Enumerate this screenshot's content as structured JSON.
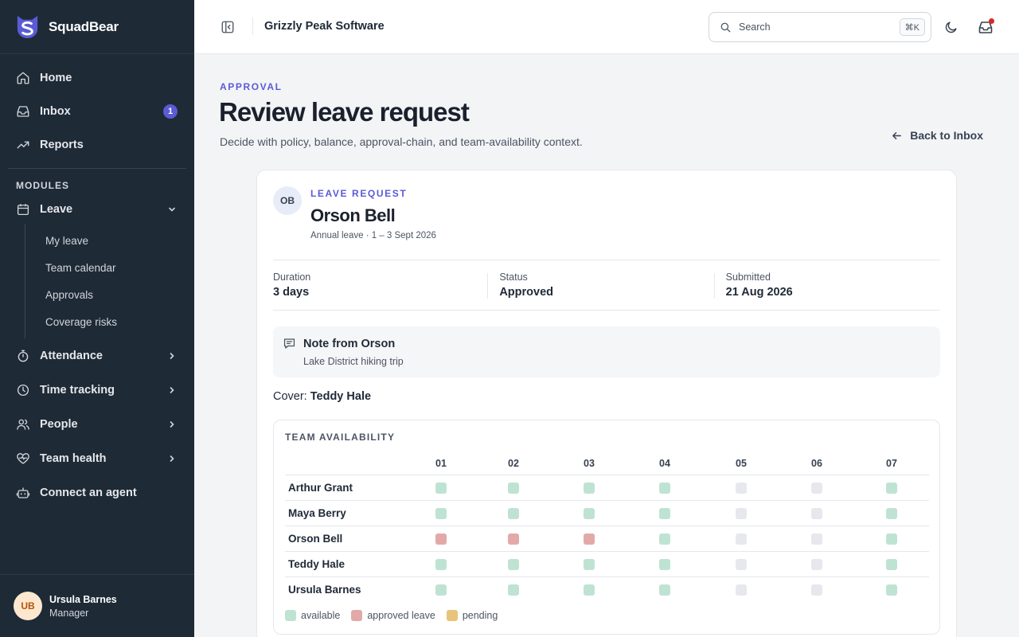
{
  "app": {
    "brand_name": "SquadBear",
    "org_name": "Grizzly Peak Software"
  },
  "sidebar": {
    "top_items": [
      {
        "label": "Home",
        "icon": "home-icon"
      },
      {
        "label": "Inbox",
        "icon": "inbox-icon",
        "badge": "1"
      },
      {
        "label": "Reports",
        "icon": "trend-up-icon"
      }
    ],
    "modules_label": "MODULES",
    "leave": {
      "label": "Leave",
      "sub_items": [
        "My leave",
        "Team calendar",
        "Approvals",
        "Coverage risks"
      ]
    },
    "groups": [
      {
        "label": "Attendance",
        "icon": "stopwatch-icon"
      },
      {
        "label": "Time tracking",
        "icon": "clock-icon"
      },
      {
        "label": "People",
        "icon": "users-icon"
      },
      {
        "label": "Team health",
        "icon": "heart-pulse-icon"
      }
    ],
    "connect_agent": "Connect an agent",
    "user": {
      "initials": "UB",
      "name": "Ursula Barnes",
      "role": "Manager"
    }
  },
  "topbar": {
    "search_placeholder": "Search",
    "search_shortcut": "⌘K"
  },
  "page": {
    "eyebrow": "APPROVAL",
    "title": "Review leave request",
    "subtitle": "Decide with policy, balance, approval-chain, and team-availability context.",
    "back_label": "Back to Inbox"
  },
  "request": {
    "initials": "OB",
    "eyebrow": "LEAVE REQUEST",
    "name": "Orson Bell",
    "meta": "Annual leave · 1 – 3 Sept 2026",
    "stats": [
      {
        "label": "Duration",
        "value": "3 days"
      },
      {
        "label": "Status",
        "value": "Approved"
      },
      {
        "label": "Submitted",
        "value": "21 Aug 2026"
      }
    ],
    "note_title": "Note from Orson",
    "note_body": "Lake District hiking trip",
    "cover_label": "Cover:",
    "cover_name": "Teddy Hale"
  },
  "availability": {
    "title": "TEAM AVAILABILITY",
    "days": [
      "01",
      "02",
      "03",
      "04",
      "05",
      "06",
      "07"
    ],
    "rows": [
      {
        "name": "Arthur Grant",
        "cells": [
          "available",
          "available",
          "available",
          "available",
          "off",
          "off",
          "available"
        ]
      },
      {
        "name": "Maya Berry",
        "cells": [
          "available",
          "available",
          "available",
          "available",
          "off",
          "off",
          "available"
        ]
      },
      {
        "name": "Orson Bell",
        "cells": [
          "approved",
          "approved",
          "approved",
          "available",
          "off",
          "off",
          "available"
        ]
      },
      {
        "name": "Teddy Hale",
        "cells": [
          "available",
          "available",
          "available",
          "available",
          "off",
          "off",
          "available"
        ]
      },
      {
        "name": "Ursula Barnes",
        "cells": [
          "available",
          "available",
          "available",
          "available",
          "off",
          "off",
          "available"
        ]
      }
    ],
    "legend": [
      {
        "key": "available",
        "label": "available"
      },
      {
        "key": "approved",
        "label": "approved leave"
      },
      {
        "key": "pending",
        "label": "pending"
      }
    ],
    "colors": {
      "available": "#bfe3d3",
      "approved": "#e2a9a9",
      "pending": "#e8c37a",
      "off": "#e6e8ed"
    }
  }
}
